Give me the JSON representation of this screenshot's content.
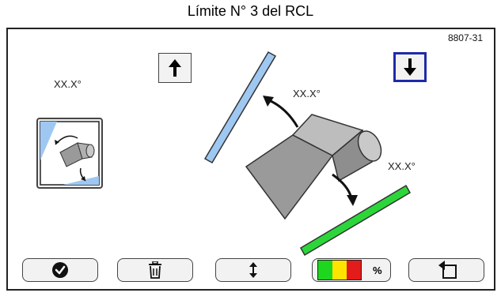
{
  "caption": "Límite N° 3 del RCL",
  "figure_id": "8807-31",
  "angles": {
    "left": "XX.X°",
    "upper_arm": "XX.X°",
    "lower_arm": "XX.X°"
  },
  "colors": {
    "selection_border": "#1e2aa8",
    "upper_limit_bar": "#9ec8f2",
    "lower_limit_bar": "#2cd63a",
    "indicator_green": "#1fd61f",
    "indicator_yellow": "#ffe400",
    "indicator_red": "#e31b1b"
  },
  "indicator": {
    "unit": "%"
  },
  "icons": {
    "up": "arrow-up-icon",
    "down": "arrow-down-icon",
    "mode": "limit-adjust-icon",
    "confirm": "checkmark-icon",
    "delete": "trash-icon",
    "toggle": "up-down-arrows-icon",
    "back": "back-arrow-icon"
  }
}
